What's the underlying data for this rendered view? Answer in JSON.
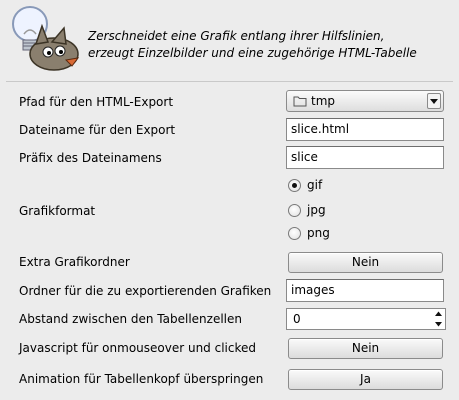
{
  "header": {
    "description_line1": "Zerschneidet eine Grafik entlang ihrer Hilfslinien,",
    "description_line2": "erzeugt Einzelbilder und eine zugehörige HTML-Tabelle"
  },
  "fields": {
    "export_path": {
      "label": "Pfad für den HTML-Export",
      "value": "tmp"
    },
    "filename": {
      "label": "Dateiname für den Export",
      "value": "slice.html"
    },
    "prefix": {
      "label": "Präfix des Dateinamens",
      "value": "slice"
    },
    "format": {
      "label": "Grafikformat",
      "options": [
        "gif",
        "jpg",
        "png"
      ],
      "selected": "gif"
    },
    "extra_folder": {
      "label": "Extra Grafikordner",
      "value": "Nein"
    },
    "image_folder": {
      "label": "Ordner für die zu exportierenden Grafiken",
      "value": "images"
    },
    "cell_spacing": {
      "label": "Abstand zwischen den Tabellenzellen",
      "value": "0"
    },
    "javascript": {
      "label": "Javascript für onmouseover und clicked",
      "value": "Nein"
    },
    "skip_animation": {
      "label": "Animation für Tabellenkopf überspringen",
      "value": "Ja"
    }
  },
  "icons": {
    "logo": "gimp-wilber-lightbulb-icon",
    "folder": "folder-icon",
    "dropdown": "triangle-down-icon",
    "spin_up": "arrow-up-icon",
    "spin_down": "arrow-down-icon"
  }
}
